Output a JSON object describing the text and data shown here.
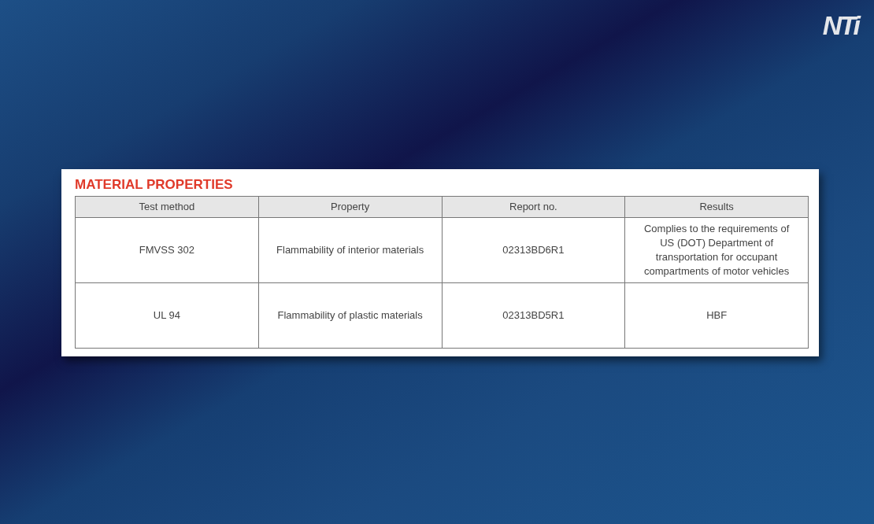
{
  "logo": "NTi",
  "card": {
    "title": "MATERIAL PROPERTIES",
    "table": {
      "columns": [
        "Test method",
        "Property",
        "Report no.",
        "Results"
      ],
      "rows": [
        [
          "FMVSS 302",
          "Flammability of interior materials",
          "02313BD6R1",
          "Complies to the requirements of US (DOT) Department of transportation for occupant compartments of motor vehicles"
        ],
        [
          "UL 94",
          "Flammability of plastic materials",
          "02313BD5R1",
          "HBF"
        ]
      ]
    }
  }
}
